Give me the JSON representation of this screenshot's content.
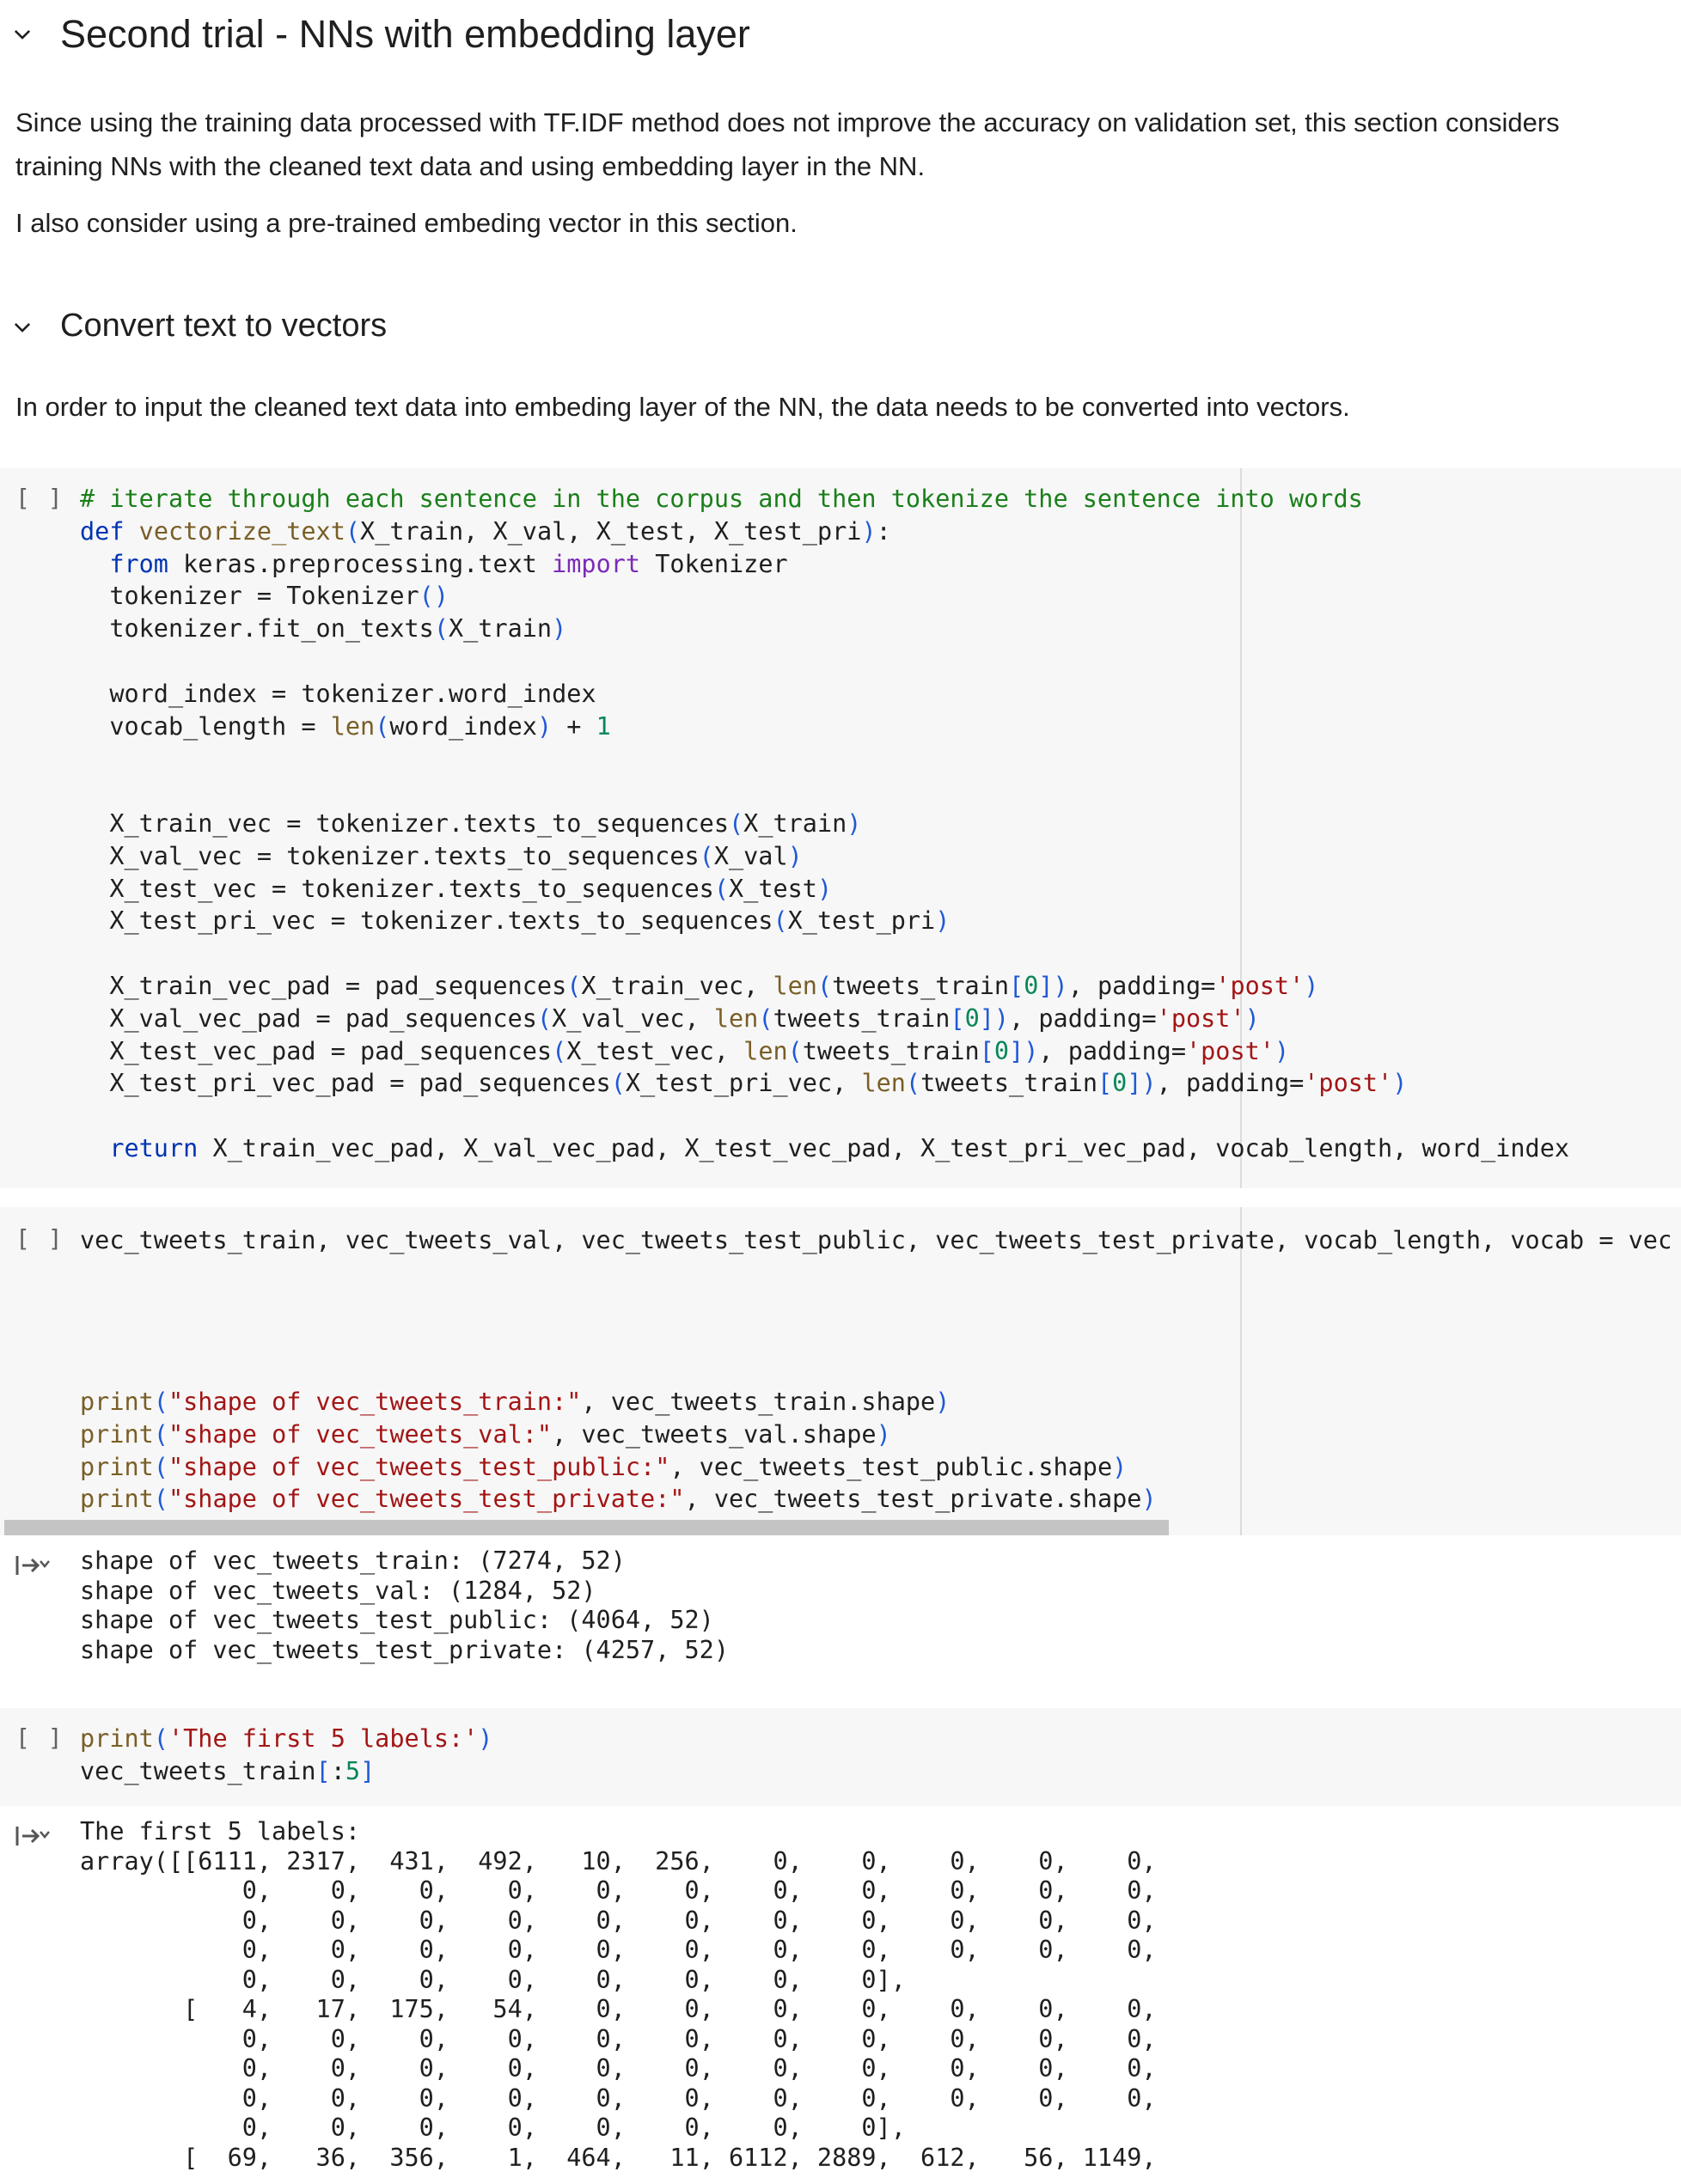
{
  "sections": {
    "second_trial": {
      "title": "Second trial - NNs with embedding layer",
      "icon": "chevron-down-icon"
    },
    "intro_paragraph": "Since using the training data processed with TF.IDF method does not improve the accuracy on validation set, this section considers training NNs with the cleaned text data and using embedding layer in the NN.",
    "intro_paragraph2": "I also consider using a pre-trained embeding vector in this section.",
    "convert": {
      "title": "Convert text to vectors",
      "icon": "chevron-down-icon"
    },
    "convert_paragraph": "In order to input the cleaned text data into embeding layer of the NN, the data needs to be converted into vectors."
  },
  "cells": {
    "gutter_label": "[ ]",
    "cell1": {
      "comment": "# iterate through each sentence in the corpus and then tokenize the sentence into words"
    },
    "cell2": {
      "line1": "vec_tweets_train, vec_tweets_val, vec_tweets_test_public, vec_tweets_test_private, vocab_length, vocab = vecto"
    },
    "cell2_output": [
      "shape of vec_tweets_train: (7274, 52)",
      "shape of vec_tweets_val: (1284, 52)",
      "shape of vec_tweets_test_public: (4064, 52)",
      "shape of vec_tweets_test_private: (4257, 52)"
    ],
    "cell3_output": [
      "The first 5 labels:",
      "array([[6111, 2317,  431,  492,   10,  256,    0,    0,    0,    0,    0,",
      "           0,    0,    0,    0,    0,    0,    0,    0,    0,    0,    0,",
      "           0,    0,    0,    0,    0,    0,    0,    0,    0,    0,    0,",
      "           0,    0,    0,    0,    0,    0,    0,    0,    0,    0,    0,",
      "           0,    0,    0,    0,    0,    0,    0,    0],",
      "       [   4,   17,  175,   54,    0,    0,    0,    0,    0,    0,    0,",
      "           0,    0,    0,    0,    0,    0,    0,    0,    0,    0,    0,",
      "           0,    0,    0,    0,    0,    0,    0,    0,    0,    0,    0,",
      "           0,    0,    0,    0,    0,    0,    0,    0,    0,    0,    0,",
      "           0,    0,    0,    0,    0,    0,    0,    0],",
      "       [  69,   36,  356,    1,  464,   11, 6112, 2889,  612,   56, 1149,"
    ]
  }
}
